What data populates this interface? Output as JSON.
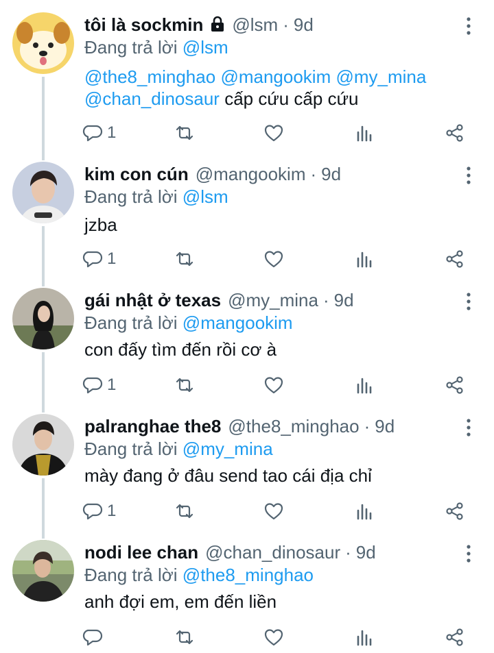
{
  "reply_prefix": "Đang trả lời",
  "tweets": [
    {
      "name": "tôi là sockmin",
      "locked": true,
      "handle": "@lsm",
      "time": "9d",
      "reply_to": "@lsm",
      "text_lines": [
        [
          {
            "t": "@the8_minghao",
            "m": true
          },
          {
            "t": " "
          },
          {
            "t": "@mangookim",
            "m": true
          },
          {
            "t": " "
          },
          {
            "t": "@my_mina",
            "m": true
          }
        ],
        [
          {
            "t": "@chan_dinosaur",
            "m": true
          },
          {
            "t": " cấp cứu cấp cứu"
          }
        ]
      ],
      "reply_count": "1",
      "avatar": "dog-avatar"
    },
    {
      "name": "kim con cún",
      "handle": "@mangookim",
      "time": "9d",
      "reply_to": "@lsm",
      "text_lines": [
        [
          {
            "t": "jzba"
          }
        ]
      ],
      "reply_count": "1",
      "avatar": "man-white-jacket-avatar"
    },
    {
      "name": "gái nhật ở texas",
      "handle": "@my_mina",
      "time": "9d",
      "reply_to": "@mangookim",
      "text_lines": [
        [
          {
            "t": "con đấy tìm đến rồi cơ à"
          }
        ]
      ],
      "reply_count": "1",
      "avatar": "woman-field-avatar"
    },
    {
      "name": "palranghae the8",
      "handle": "@the8_minghao",
      "time": "9d",
      "reply_to": "@my_mina",
      "text_lines": [
        [
          {
            "t": "mày đang ở đâu send tao cái địa chỉ"
          }
        ]
      ],
      "reply_count": "1",
      "avatar": "man-black-coat-avatar"
    },
    {
      "name": "nodi lee chan",
      "handle": "@chan_dinosaur",
      "time": "9d",
      "reply_to": "@the8_minghao",
      "text_lines": [
        [
          {
            "t": "anh đợi em, em đến liền"
          }
        ]
      ],
      "reply_count": "",
      "avatar": "man-outdoor-avatar"
    }
  ],
  "colors": {
    "mention": "#1d9bf0",
    "secondary": "#536471",
    "line": "#cfd9de"
  }
}
